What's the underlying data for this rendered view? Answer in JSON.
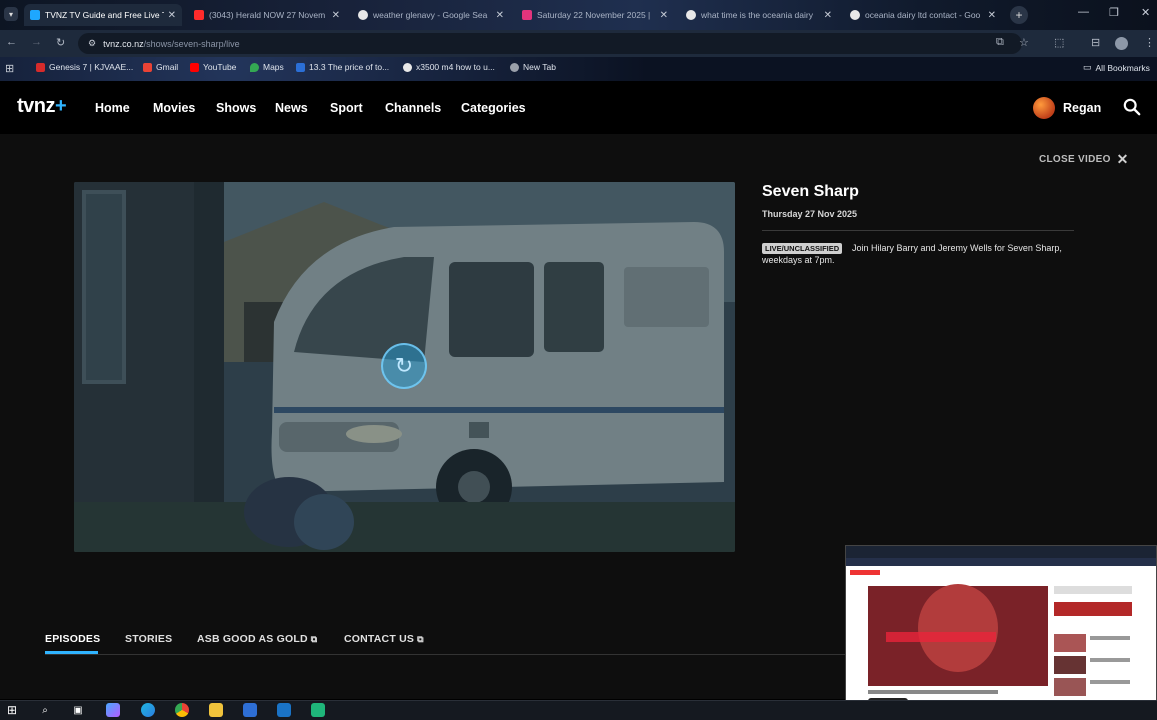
{
  "browser": {
    "tabs": [
      {
        "label": "TVNZ TV Guide and Free Live T",
        "favicon_color": "#1ea7ff",
        "active": true
      },
      {
        "label": "(3043) Herald NOW 27 Novem",
        "favicon_color": "#ff2b2b",
        "active": false
      },
      {
        "label": "weather glenavy - Google Sea",
        "favicon_color": "#e8e8e8",
        "active": false
      },
      {
        "label": "Saturday 22 November 2025 |",
        "favicon_color": "#e2347c",
        "active": false
      },
      {
        "label": "what time is the oceania dairy",
        "favicon_color": "#e8e8e8",
        "active": false
      },
      {
        "label": "oceania dairy ltd contact - Goo",
        "favicon_color": "#e8e8e8",
        "active": false
      }
    ],
    "new_tab_glyph": "+",
    "url_host": "tvnz.co.nz",
    "url_path": "/shows/seven-sharp/live",
    "bookmarks": [
      {
        "label": "Genesis 7 | KJVAAE...",
        "favicon_color": "#d62b2b"
      },
      {
        "label": "Gmail",
        "favicon_color": "#ea4335"
      },
      {
        "label": "YouTube",
        "favicon_color": "#ff0000"
      },
      {
        "label": "Maps",
        "favicon_color": "#34a853"
      },
      {
        "label": "13.3 The price of to...",
        "favicon_color": "#2b6fd6"
      },
      {
        "label": "x3500 m4 how to u...",
        "favicon_color": "#e8e8e8"
      },
      {
        "label": "New Tab",
        "favicon_color": "#9aa0aa"
      }
    ],
    "all_bookmarks_label": "All Bookmarks"
  },
  "site": {
    "logo_text": "tvnz",
    "logo_plus": "+",
    "nav": [
      "Home",
      "Movies",
      "Shows",
      "News",
      "Sport",
      "Channels",
      "Categories"
    ],
    "username": "Regan",
    "close_video_label": "CLOSE VIDEO"
  },
  "show": {
    "title": "Seven Sharp",
    "date": "Thursday 27 Nov 2025",
    "badge": "LIVE/UNCLASSIFIED",
    "description": "Join Hilary Barry and Jeremy Wells for Seven Sharp, weekdays at 7pm."
  },
  "subtabs": [
    {
      "label": "EPISODES",
      "external": false,
      "active": true
    },
    {
      "label": "STORIES",
      "external": false,
      "active": false
    },
    {
      "label": "ASB GOOD AS GOLD",
      "external": true,
      "active": false
    },
    {
      "label": "CONTACT US",
      "external": true,
      "active": false
    }
  ],
  "colors": {
    "accent": "#30b4ff",
    "page_bg": "#0e0e0e",
    "nav_bg": "#000000"
  }
}
